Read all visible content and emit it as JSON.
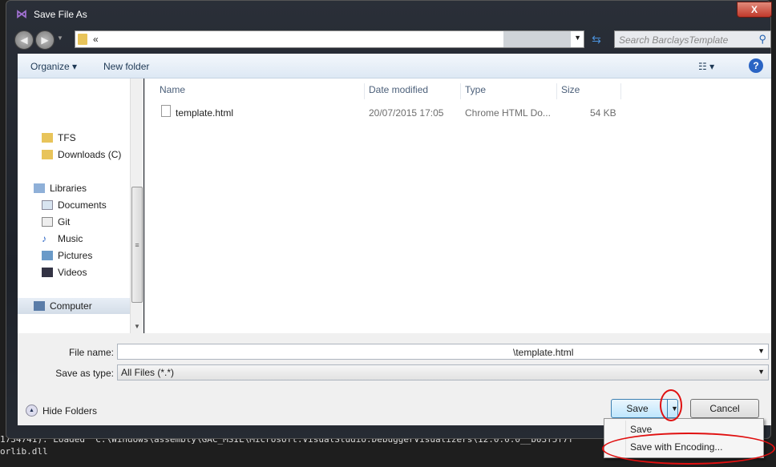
{
  "window": {
    "title": "Save File As",
    "close": "X"
  },
  "address": {
    "path": "«",
    "search_placeholder": "Search BarclaysTemplate"
  },
  "toolbar": {
    "organize": "Organize ▾",
    "new_folder": "New folder",
    "view": "☷ ▾",
    "help": "?"
  },
  "nav": {
    "items": [
      {
        "label": "TFS",
        "icon": "folder-icon"
      },
      {
        "label": "Downloads (C)",
        "icon": "folder-icon"
      },
      {
        "label": "Libraries",
        "icon": "libraries-icon"
      },
      {
        "label": "Documents",
        "icon": "documents-icon"
      },
      {
        "label": "Git",
        "icon": "git-icon"
      },
      {
        "label": "Music",
        "icon": "music-icon"
      },
      {
        "label": "Pictures",
        "icon": "pictures-icon"
      },
      {
        "label": "Videos",
        "icon": "videos-icon"
      },
      {
        "label": "Computer",
        "icon": "computer-icon"
      }
    ]
  },
  "files": {
    "columns": [
      "Name",
      "Date modified",
      "Type",
      "Size"
    ],
    "rows": [
      {
        "name": "template.html",
        "date": "20/07/2015 17:05",
        "type": "Chrome HTML Do...",
        "size": "54 KB"
      }
    ]
  },
  "form": {
    "file_name_label": "File name:",
    "file_name_value": "\\template.html",
    "type_label": "Save as type:",
    "type_value": "All Files (*.*)"
  },
  "buttons": {
    "hide_folders": "Hide Folders",
    "save": "Save",
    "cancel": "Cancel"
  },
  "save_menu": {
    "items": [
      "Save",
      "Save with Encoding..."
    ]
  },
  "console": {
    "line1": "1734741): Loaded 'C:\\Windows\\assembly\\GAC_MSIL\\Microsoft.VisualStudio.DebuggerVisualizers\\12.0.0.0__b03f5f7f",
    "line2": "orlib.dll"
  },
  "colors": {
    "annotation": "#e01010",
    "accent": "#3c7fb1"
  }
}
